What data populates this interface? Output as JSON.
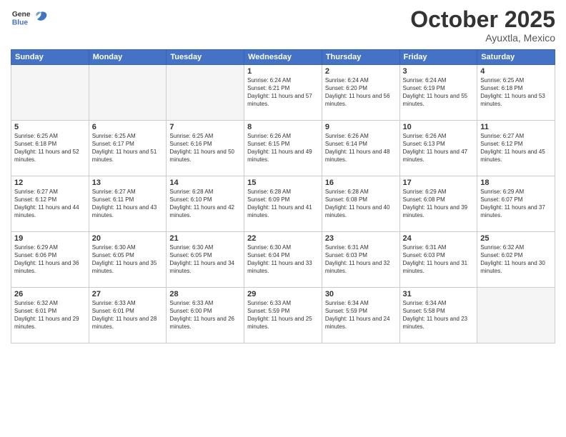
{
  "header": {
    "logo_general": "General",
    "logo_blue": "Blue",
    "month": "October 2025",
    "location": "Ayuxtla, Mexico"
  },
  "weekdays": [
    "Sunday",
    "Monday",
    "Tuesday",
    "Wednesday",
    "Thursday",
    "Friday",
    "Saturday"
  ],
  "weeks": [
    [
      {
        "day": "",
        "empty": true
      },
      {
        "day": "",
        "empty": true
      },
      {
        "day": "",
        "empty": true
      },
      {
        "day": "1",
        "sunrise": "6:24 AM",
        "sunset": "6:21 PM",
        "daylight": "11 hours and 57 minutes."
      },
      {
        "day": "2",
        "sunrise": "6:24 AM",
        "sunset": "6:20 PM",
        "daylight": "11 hours and 56 minutes."
      },
      {
        "day": "3",
        "sunrise": "6:24 AM",
        "sunset": "6:19 PM",
        "daylight": "11 hours and 55 minutes."
      },
      {
        "day": "4",
        "sunrise": "6:25 AM",
        "sunset": "6:18 PM",
        "daylight": "11 hours and 53 minutes."
      }
    ],
    [
      {
        "day": "5",
        "sunrise": "6:25 AM",
        "sunset": "6:18 PM",
        "daylight": "11 hours and 52 minutes."
      },
      {
        "day": "6",
        "sunrise": "6:25 AM",
        "sunset": "6:17 PM",
        "daylight": "11 hours and 51 minutes."
      },
      {
        "day": "7",
        "sunrise": "6:25 AM",
        "sunset": "6:16 PM",
        "daylight": "11 hours and 50 minutes."
      },
      {
        "day": "8",
        "sunrise": "6:26 AM",
        "sunset": "6:15 PM",
        "daylight": "11 hours and 49 minutes."
      },
      {
        "day": "9",
        "sunrise": "6:26 AM",
        "sunset": "6:14 PM",
        "daylight": "11 hours and 48 minutes."
      },
      {
        "day": "10",
        "sunrise": "6:26 AM",
        "sunset": "6:13 PM",
        "daylight": "11 hours and 47 minutes."
      },
      {
        "day": "11",
        "sunrise": "6:27 AM",
        "sunset": "6:12 PM",
        "daylight": "11 hours and 45 minutes."
      }
    ],
    [
      {
        "day": "12",
        "sunrise": "6:27 AM",
        "sunset": "6:12 PM",
        "daylight": "11 hours and 44 minutes."
      },
      {
        "day": "13",
        "sunrise": "6:27 AM",
        "sunset": "6:11 PM",
        "daylight": "11 hours and 43 minutes."
      },
      {
        "day": "14",
        "sunrise": "6:28 AM",
        "sunset": "6:10 PM",
        "daylight": "11 hours and 42 minutes."
      },
      {
        "day": "15",
        "sunrise": "6:28 AM",
        "sunset": "6:09 PM",
        "daylight": "11 hours and 41 minutes."
      },
      {
        "day": "16",
        "sunrise": "6:28 AM",
        "sunset": "6:08 PM",
        "daylight": "11 hours and 40 minutes."
      },
      {
        "day": "17",
        "sunrise": "6:29 AM",
        "sunset": "6:08 PM",
        "daylight": "11 hours and 39 minutes."
      },
      {
        "day": "18",
        "sunrise": "6:29 AM",
        "sunset": "6:07 PM",
        "daylight": "11 hours and 37 minutes."
      }
    ],
    [
      {
        "day": "19",
        "sunrise": "6:29 AM",
        "sunset": "6:06 PM",
        "daylight": "11 hours and 36 minutes."
      },
      {
        "day": "20",
        "sunrise": "6:30 AM",
        "sunset": "6:05 PM",
        "daylight": "11 hours and 35 minutes."
      },
      {
        "day": "21",
        "sunrise": "6:30 AM",
        "sunset": "6:05 PM",
        "daylight": "11 hours and 34 minutes."
      },
      {
        "day": "22",
        "sunrise": "6:30 AM",
        "sunset": "6:04 PM",
        "daylight": "11 hours and 33 minutes."
      },
      {
        "day": "23",
        "sunrise": "6:31 AM",
        "sunset": "6:03 PM",
        "daylight": "11 hours and 32 minutes."
      },
      {
        "day": "24",
        "sunrise": "6:31 AM",
        "sunset": "6:03 PM",
        "daylight": "11 hours and 31 minutes."
      },
      {
        "day": "25",
        "sunrise": "6:32 AM",
        "sunset": "6:02 PM",
        "daylight": "11 hours and 30 minutes."
      }
    ],
    [
      {
        "day": "26",
        "sunrise": "6:32 AM",
        "sunset": "6:01 PM",
        "daylight": "11 hours and 29 minutes."
      },
      {
        "day": "27",
        "sunrise": "6:33 AM",
        "sunset": "6:01 PM",
        "daylight": "11 hours and 28 minutes."
      },
      {
        "day": "28",
        "sunrise": "6:33 AM",
        "sunset": "6:00 PM",
        "daylight": "11 hours and 26 minutes."
      },
      {
        "day": "29",
        "sunrise": "6:33 AM",
        "sunset": "5:59 PM",
        "daylight": "11 hours and 25 minutes."
      },
      {
        "day": "30",
        "sunrise": "6:34 AM",
        "sunset": "5:59 PM",
        "daylight": "11 hours and 24 minutes."
      },
      {
        "day": "31",
        "sunrise": "6:34 AM",
        "sunset": "5:58 PM",
        "daylight": "11 hours and 23 minutes."
      },
      {
        "day": "",
        "empty": true
      }
    ]
  ]
}
